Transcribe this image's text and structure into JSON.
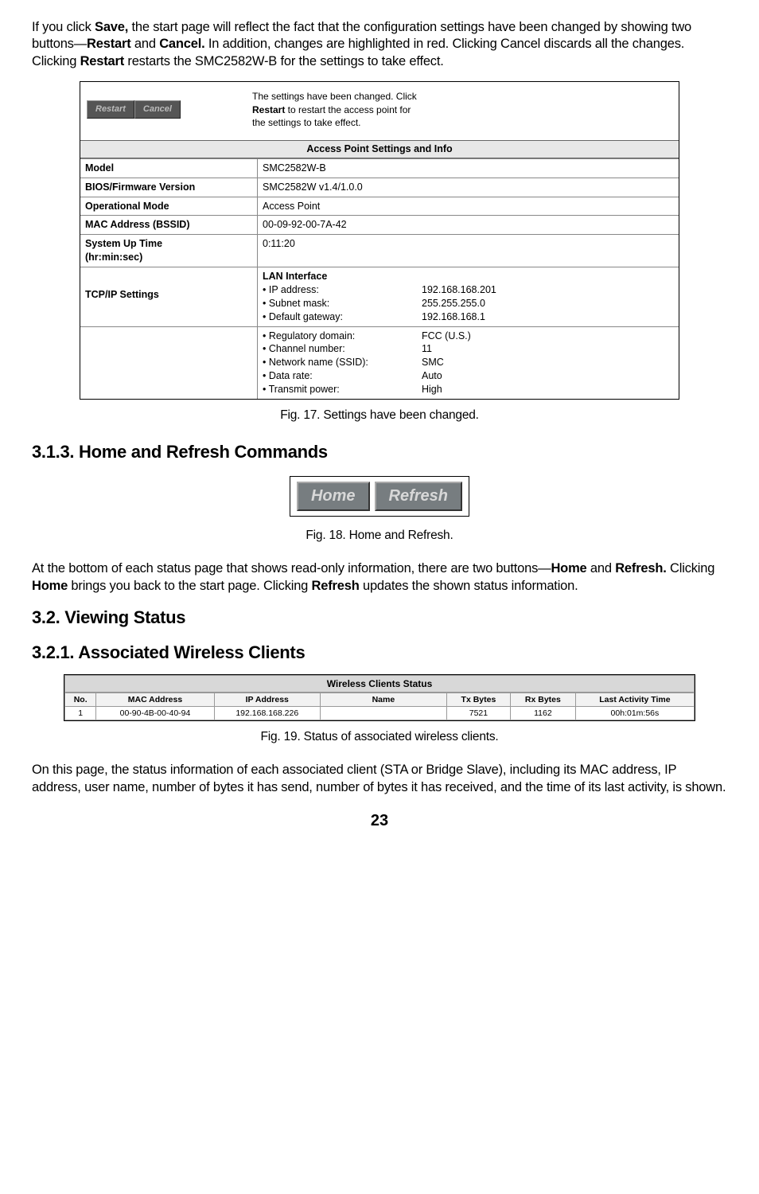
{
  "para1": {
    "pre": "If you click ",
    "save": "Save,",
    "s1": " the start page will reflect the fact that the configuration settings have been changed by showing two buttons—",
    "restart": "Restart",
    "and": " and ",
    "cancel": "Cancel.",
    "s2": " In addition, changes are highlighted in red. Clicking Cancel discards all the changes. Clicking ",
    "restart2": "Restart",
    "s3": " restarts the SMC2582W-B for the settings to take effect."
  },
  "box": {
    "btn_restart": "Restart",
    "btn_cancel": "Cancel",
    "msg_l1": "The settings have been changed. Click",
    "msg_l2a": "Restart",
    "msg_l2b": " to restart the access point for",
    "msg_l3": "the settings to take effect.",
    "section": "Access Point Settings and Info",
    "rows": {
      "model_k": "Model",
      "model_v": "SMC2582W-B",
      "bios_k": "BIOS/Firmware Version",
      "bios_v": "SMC2582W v1.4/1.0.0",
      "mode_k": "Operational Mode",
      "mode_v": "Access Point",
      "mac_k": "MAC Address (BSSID)",
      "mac_v": "00-09-92-00-7A-42",
      "uptime_k1": "System Up Time",
      "uptime_k2": "(hr:min:sec)",
      "uptime_v": "0:11:20",
      "tcp_k": "TCP/IP Settings",
      "lan_head": "LAN Interface",
      "ip_k": "• IP address:",
      "ip_v": "192.168.168.201",
      "sn_k": "• Subnet mask:",
      "sn_v": "255.255.255.0",
      "gw_k": "• Default gateway:",
      "gw_v": "192.168.168.1",
      "reg_k": "• Regulatory domain:",
      "reg_v": "FCC (U.S.)",
      "ch_k": "• Channel number:",
      "ch_v": "11",
      "ssid_k": "• Network name (SSID):",
      "ssid_v": "SMC",
      "dr_k": "• Data rate:",
      "dr_v": "Auto",
      "tp_k": "• Transmit power:",
      "tp_v": "High"
    }
  },
  "cap17": "Fig. 17. Settings have been changed.",
  "h313": "3.1.3. Home and Refresh Commands",
  "home_btn": "Home",
  "refresh_btn": "Refresh",
  "cap18": "Fig. 18. Home and Refresh.",
  "para2": {
    "pre": "At the bottom of each status page that shows read-only information, there are two buttons—",
    "home": "Home",
    "and": " and ",
    "refresh": "Refresh.",
    "c": " Clicking ",
    "home2": "Home",
    "s1": " brings you back to the start page. Clicking ",
    "refresh2": "Refresh",
    "s2": " updates the shown status information."
  },
  "h32": "3.2. Viewing Status",
  "h321": "3.2.1. Associated Wireless Clients",
  "wtable": {
    "title": "Wireless Clients Status",
    "h_no": "No.",
    "h_mac": "MAC Address",
    "h_ip": "IP Address",
    "h_name": "Name",
    "h_tx": "Tx Bytes",
    "h_rx": "Rx Bytes",
    "h_last": "Last Activity Time",
    "r_no": "1",
    "r_mac": "00-90-4B-00-40-94",
    "r_ip": "192.168.168.226",
    "r_name": "",
    "r_tx": "7521",
    "r_rx": "1162",
    "r_last": "00h:01m:56s"
  },
  "cap19": "Fig. 19. Status of associated wireless clients.",
  "para3": "On this page, the status information of each associated client (STA or Bridge Slave), including its MAC address, IP address, user name, number of bytes it has send, number of bytes it has received, and the time of its last activity, is shown.",
  "pagenum": "23"
}
